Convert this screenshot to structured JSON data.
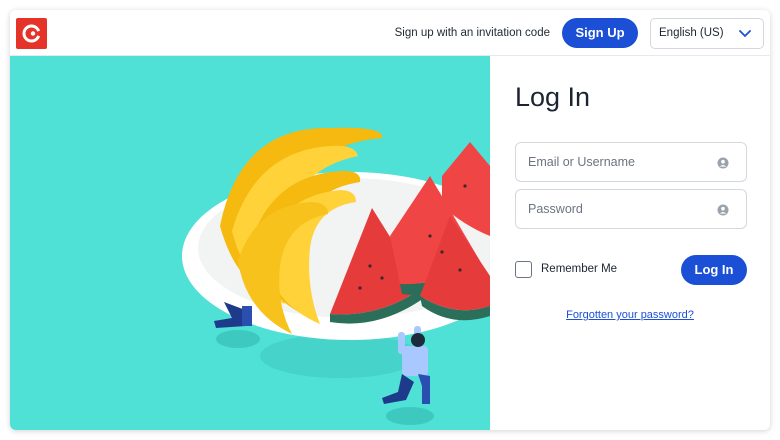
{
  "header": {
    "logo_icon": "brand-logo",
    "invite_text": "Sign up with an invitation code",
    "signup_label": "Sign Up",
    "language": "English (US)"
  },
  "login": {
    "title": "Log In",
    "email_placeholder": "Email or Username",
    "password_placeholder": "Password",
    "remember_label": "Remember Me",
    "submit_label": "Log In",
    "forgot_label": "Forgotten your password?"
  },
  "colors": {
    "brand_red": "#e5332a",
    "primary_blue": "#1a4fd6",
    "hero_teal": "#4fe0d6"
  }
}
